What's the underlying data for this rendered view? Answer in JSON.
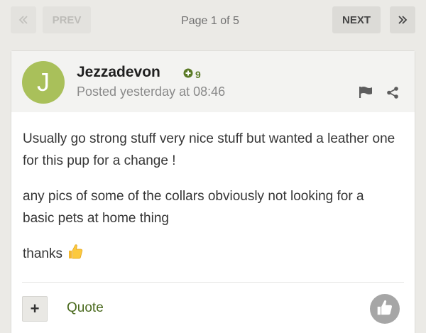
{
  "pagination": {
    "prev_label": "PREV",
    "next_label": "NEXT",
    "page_info": "Page 1 of 5"
  },
  "post": {
    "author": "Jezzadevon",
    "avatar_letter": "J",
    "reputation": "9",
    "posted": "Posted yesterday at 08:46",
    "paragraphs": [
      "Usually go strong stuff very nice stuff but wanted a leather one for this pup for a change !",
      "any pics of some of the collars obviously not looking for a basic pets at home thing",
      "thanks"
    ],
    "quote_label": "Quote",
    "multiquote_symbol": "+"
  },
  "icons": {
    "first": "double-chevron-left-icon",
    "last": "double-chevron-right-icon",
    "reputation": "plus-circle-icon",
    "report": "flag-icon",
    "share": "share-icon",
    "emoji": "thumbs-up-emoji",
    "like": "thumbs-up-icon"
  },
  "colors": {
    "background": "#ebeae6",
    "avatar": "#a9c05a",
    "reputation": "#5a7a26",
    "link": "#4a6a1e",
    "like_button": "#a6a6a6"
  }
}
